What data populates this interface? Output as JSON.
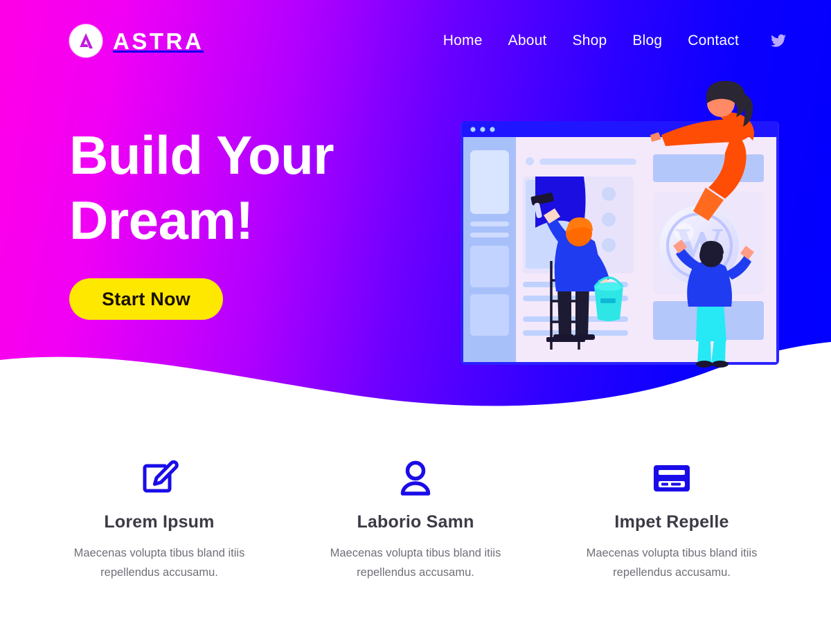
{
  "brand": {
    "name": "ASTRA",
    "logo_icon": "astra-a-logo-icon",
    "logo_letter": "A"
  },
  "nav": {
    "items": [
      {
        "label": "Home"
      },
      {
        "label": "About"
      },
      {
        "label": "Shop"
      },
      {
        "label": "Blog"
      },
      {
        "label": "Contact"
      }
    ],
    "social": {
      "icon": "twitter-bird-icon",
      "label": "Twitter"
    }
  },
  "hero": {
    "title_line1": "Build Your",
    "title_line2": "Dream!",
    "cta_label": "Start Now",
    "illustration": {
      "name": "website-building-illustration",
      "elements": [
        "browser-window-mockup",
        "painter-on-ladder",
        "paint-bucket",
        "wordpress-logo-bubble",
        "person-holding-bubble",
        "flying-woman"
      ],
      "wordpress_letter": "W"
    },
    "colors": {
      "gradient_start": "#ff00e6",
      "gradient_end": "#0000ff",
      "cta_background": "#ffe800",
      "cta_text": "#1b1000"
    }
  },
  "features": [
    {
      "icon": "edit-pencil-icon",
      "title": "Lorem Ipsum",
      "description": "Maecenas volupta tibus bland itiis repellendus accusamu."
    },
    {
      "icon": "user-person-icon",
      "title": "Laborio Samn",
      "description": "Maecenas volupta tibus bland itiis repellendus accusamu."
    },
    {
      "icon": "credit-card-icon",
      "title": "Impet Repelle",
      "description": "Maecenas volupta tibus bland itiis repellendus accusamu."
    }
  ],
  "theme": {
    "icon_blue": "#1a0ce8",
    "heading_color": "#3b3b46",
    "body_color": "#6f6f79",
    "page_background": "#ffffff"
  }
}
